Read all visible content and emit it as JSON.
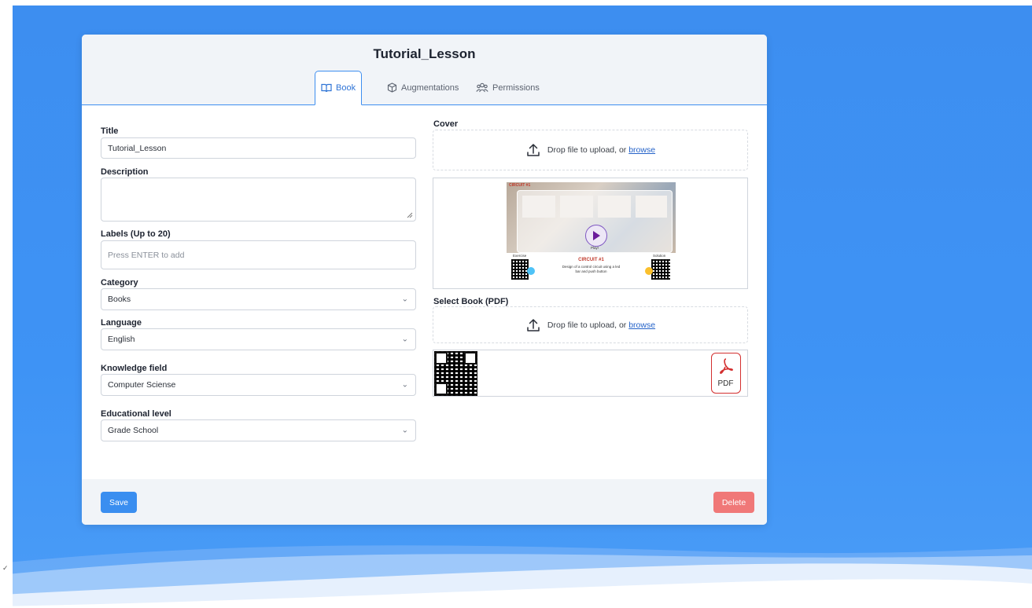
{
  "book": {
    "title": "Tutorial_Lesson"
  },
  "tabs": [
    {
      "label": "Book",
      "icon": "book-open-icon",
      "active": true
    },
    {
      "label": "Augmentations",
      "icon": "cube-icon",
      "active": false
    },
    {
      "label": "Permissions",
      "icon": "users-icon",
      "active": false
    }
  ],
  "form": {
    "title_label": "Title",
    "title_value": "Tutorial_Lesson",
    "description_label": "Description",
    "description_value": "",
    "labels_label": "Labels (Up to 20)",
    "labels_placeholder": "Press ENTER to add",
    "category_label": "Category",
    "category_value": "Books",
    "language_label": "Language",
    "language_value": "English",
    "knowledge_label": "Knowledge field",
    "knowledge_value": "Computer Sciense",
    "level_label": "Educational level",
    "level_value": "Grade School"
  },
  "cover": {
    "label": "Cover",
    "drop_text": "Drop file to upload, or ",
    "browse_text": "browse",
    "preview": {
      "header": "CIRCUIT #1",
      "play_text": "Play!",
      "exercise_label": "Exercise",
      "solution_label": "Solution",
      "circuit_title": "CIRCUIT #1",
      "circuit_desc_1": "Design of a control circuit using a led",
      "circuit_desc_2": "bar and push button"
    }
  },
  "pdf": {
    "label": "Select Book (PDF)",
    "drop_text": "Drop file to upload, or ",
    "browse_text": "browse",
    "pdf_badge": "PDF"
  },
  "actions": {
    "save_label": "Save",
    "delete_label": "Delete"
  },
  "colors": {
    "primary": "#3d8ef0",
    "save": "#3a8ef0",
    "delete": "#f07878"
  }
}
